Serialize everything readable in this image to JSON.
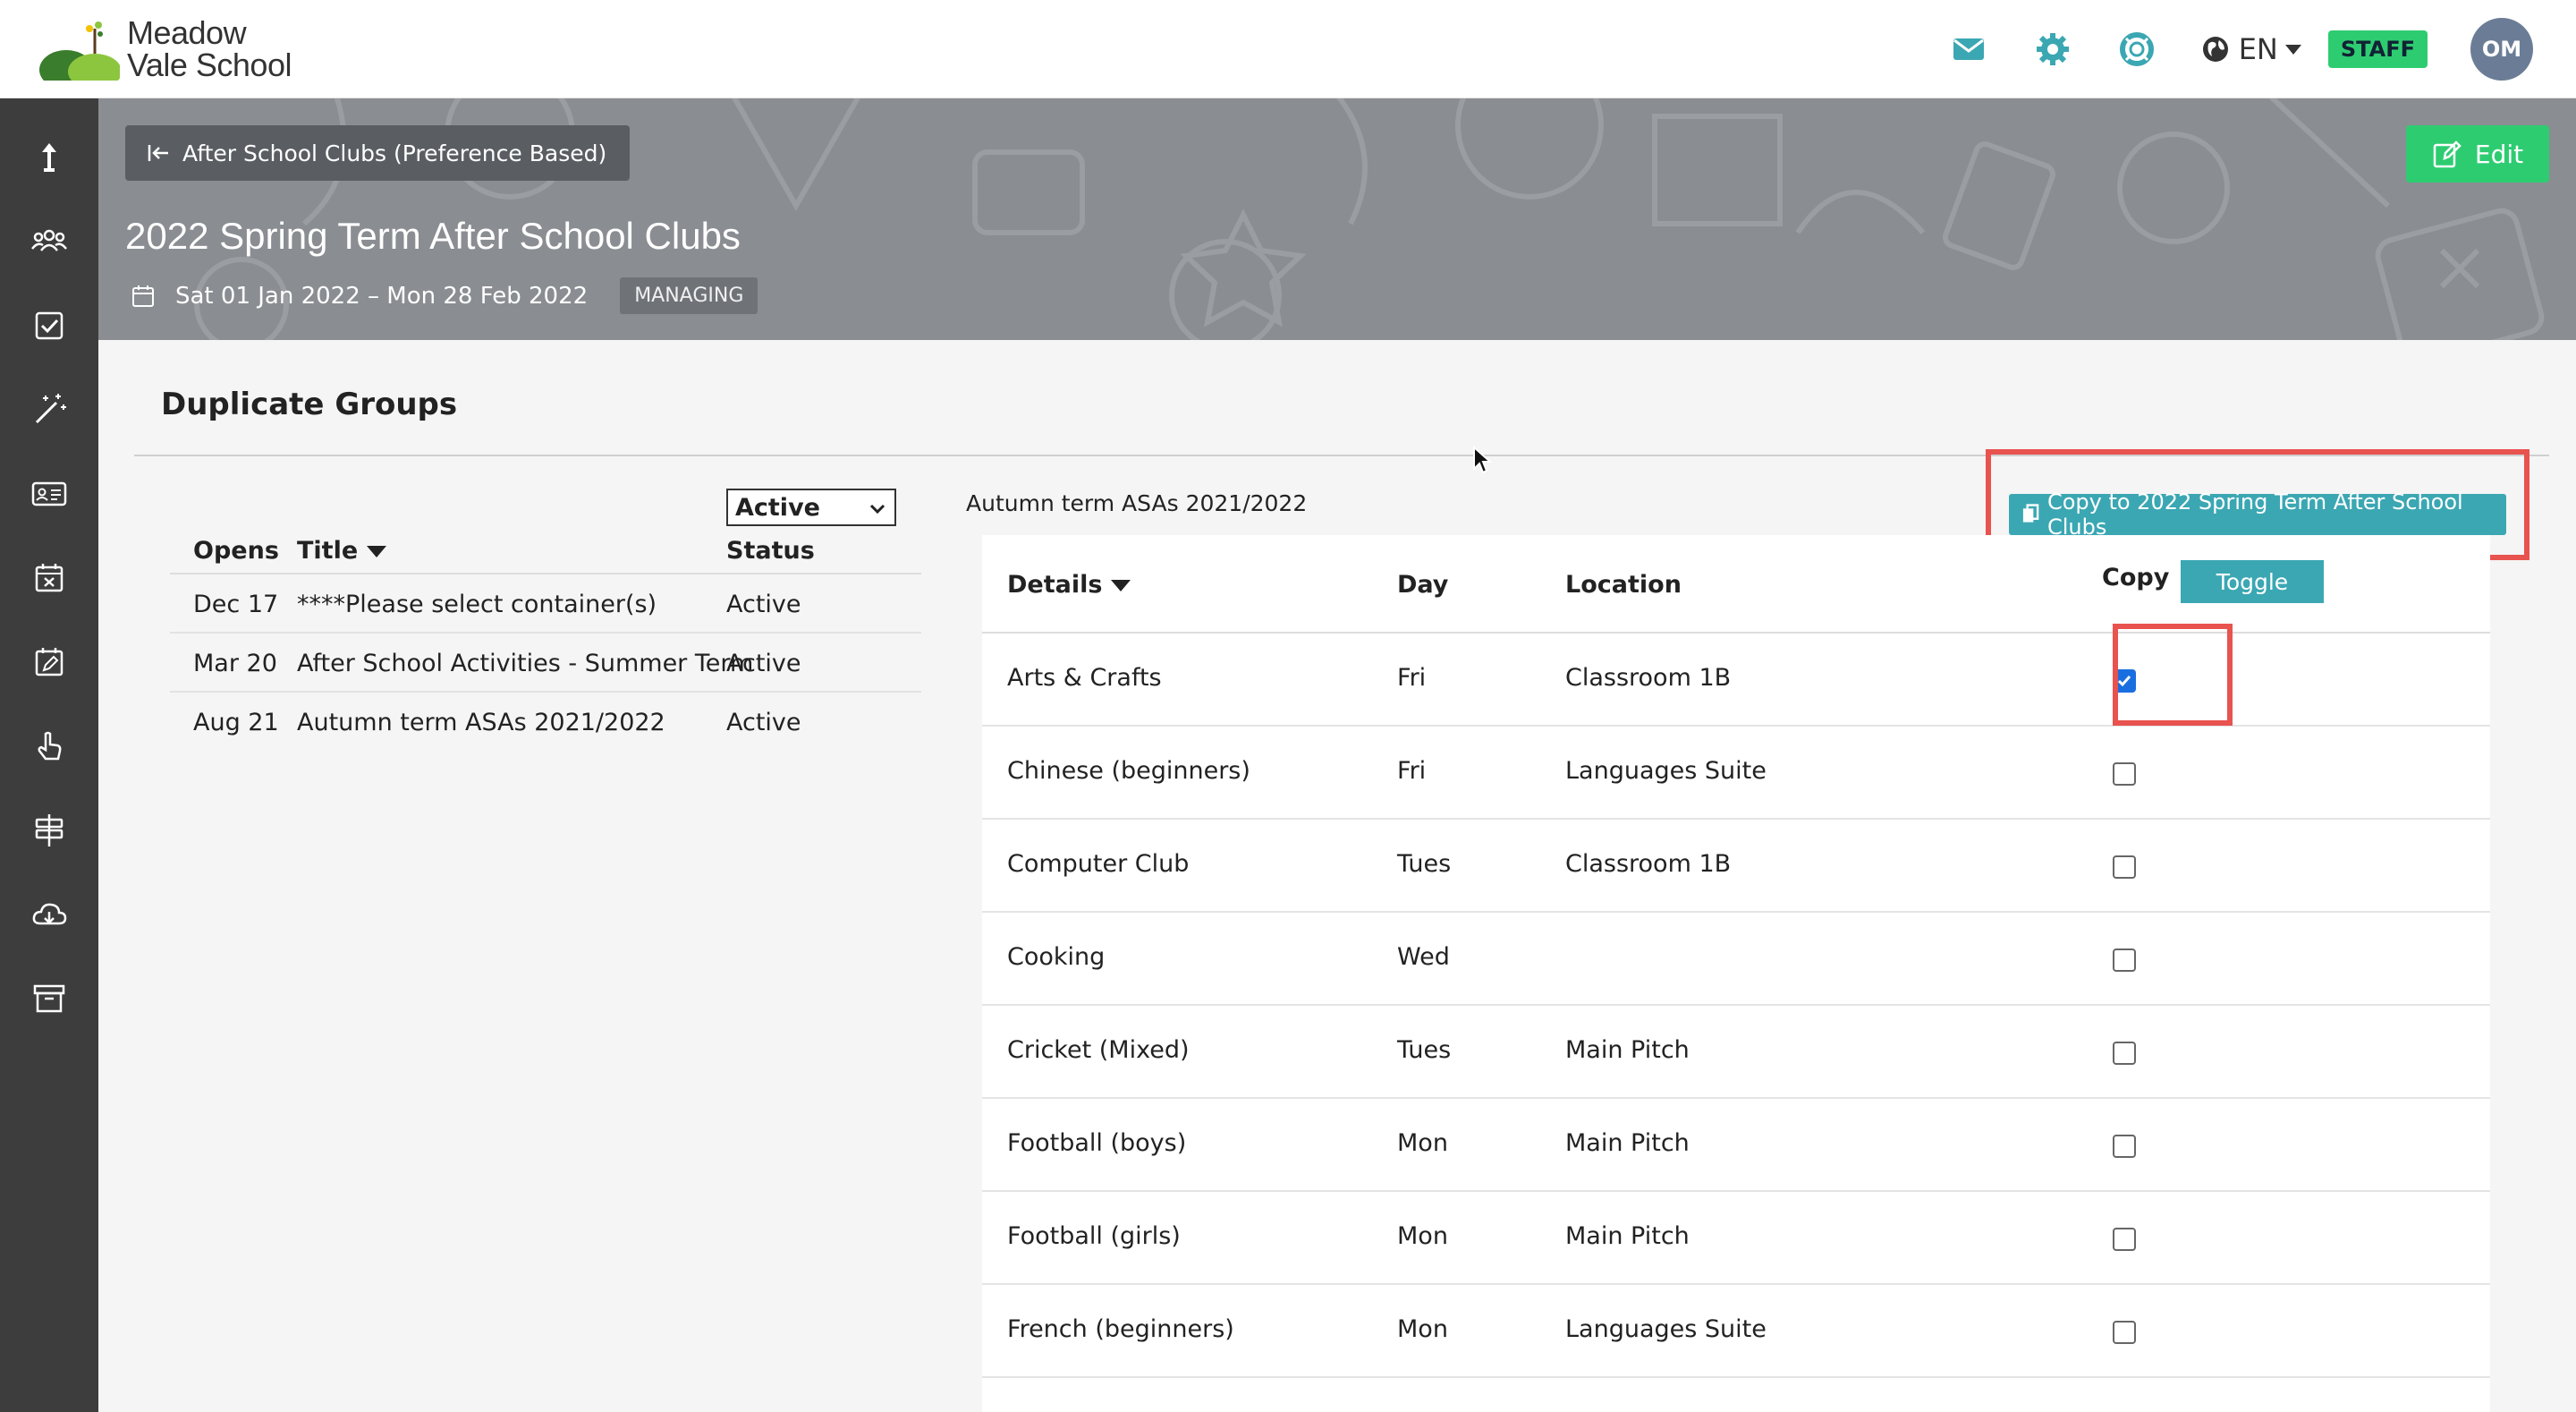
{
  "header": {
    "logo_line1": "Meadow",
    "logo_line2": "Vale School",
    "language": "EN",
    "staff_badge": "STAFF",
    "avatar_initials": "OM",
    "icons": [
      "mail-icon",
      "settings-gear-icon",
      "help-lifebuoy-icon",
      "globe-icon"
    ]
  },
  "sidebar": {
    "icons": [
      "upload-arrow-icon",
      "people-group-icon",
      "checkbox-icon",
      "magic-wand-icon",
      "id-card-icon",
      "calendar-x-icon",
      "calendar-edit-icon",
      "hand-pointer-icon",
      "signpost-icon",
      "cloud-download-icon",
      "archive-box-icon"
    ]
  },
  "banner": {
    "back_label": "After School Clubs (Preference Based)",
    "title": "2022 Spring Term After School Clubs",
    "date_range": "Sat 01 Jan 2022 – Mon 28 Feb 2022",
    "badge": "MANAGING",
    "edit_label": "Edit"
  },
  "section": {
    "title": "Duplicate Groups"
  },
  "left_table": {
    "status_filter": "Active",
    "headers": {
      "opens": "Opens",
      "title": "Title",
      "status": "Status"
    },
    "rows": [
      {
        "opens": "Dec 17",
        "title": "****Please select container(s)",
        "status": "Active"
      },
      {
        "opens": "Mar 20",
        "title": "After School Activities - Summer Term",
        "status": "Active"
      },
      {
        "opens": "Aug 21",
        "title": "Autumn term ASAs 2021/2022",
        "status": "Active"
      }
    ]
  },
  "right_panel": {
    "container_label": "Autumn term ASAs 2021/2022",
    "copy_button": "Copy to 2022 Spring Term After School Clubs",
    "headers": {
      "details": "Details",
      "day": "Day",
      "location": "Location",
      "copy": "Copy",
      "toggle": "Toggle"
    },
    "rows": [
      {
        "details": "Arts & Crafts",
        "day": "Fri",
        "location": "Classroom 1B",
        "copy": true
      },
      {
        "details": "Chinese (beginners)",
        "day": "Fri",
        "location": "Languages Suite",
        "copy": false
      },
      {
        "details": "Computer Club",
        "day": "Tues",
        "location": "Classroom 1B",
        "copy": false
      },
      {
        "details": "Cooking",
        "day": "Wed",
        "location": "",
        "copy": false
      },
      {
        "details": "Cricket (Mixed)",
        "day": "Tues",
        "location": "Main Pitch",
        "copy": false
      },
      {
        "details": "Football (boys)",
        "day": "Mon",
        "location": "Main Pitch",
        "copy": false
      },
      {
        "details": "Football (girls)",
        "day": "Mon",
        "location": "Main Pitch",
        "copy": false
      },
      {
        "details": "French (beginners)",
        "day": "Mon",
        "location": "Languages Suite",
        "copy": false
      }
    ]
  },
  "colors": {
    "accent_teal": "#3ba7b3",
    "success_green": "#2ecc71",
    "sidebar_dark": "#3d3d3d",
    "highlight_red": "#e8534f",
    "checkbox_blue": "#1a6fe0"
  }
}
